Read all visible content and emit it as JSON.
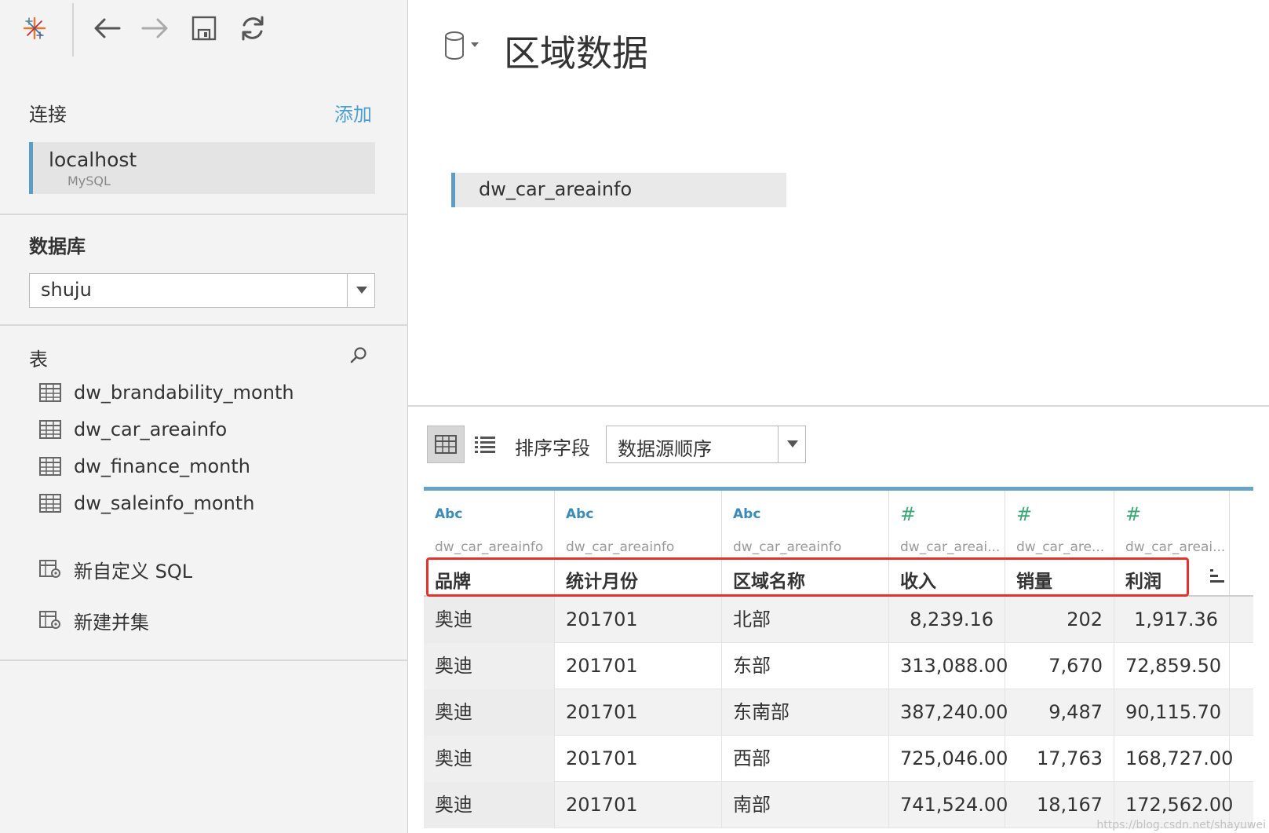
{
  "toolbar": {
    "icons": [
      "tableau-logo-icon",
      "back-arrow-icon",
      "forward-arrow-icon",
      "save-icon",
      "refresh-icon"
    ]
  },
  "sidebar": {
    "connection_label": "连接",
    "add_label": "添加",
    "connection": {
      "name": "localhost",
      "type": "MySQL"
    },
    "database_label": "数据库",
    "database_value": "shuju",
    "tables_label": "表",
    "tables": [
      {
        "label": "dw_brandability_month"
      },
      {
        "label": "dw_car_areainfo"
      },
      {
        "label": "dw_finance_month"
      },
      {
        "label": "dw_saleinfo_month"
      }
    ],
    "actions": [
      {
        "label": "新自定义 SQL"
      },
      {
        "label": "新建并集"
      }
    ]
  },
  "main": {
    "title": "区域数据",
    "canvas_table": "dw_car_areainfo",
    "grid_toolbar": {
      "sort_label": "排序字段",
      "sort_value": "数据源顺序"
    },
    "grid": {
      "columns": [
        {
          "type": "Abc",
          "source": "dw_car_areainfo",
          "name": "品牌"
        },
        {
          "type": "Abc",
          "source": "dw_car_areainfo",
          "name": "统计月份"
        },
        {
          "type": "Abc",
          "source": "dw_car_areainfo",
          "name": "区域名称"
        },
        {
          "type": "#",
          "source": "dw_car_areai...",
          "name": "收入"
        },
        {
          "type": "#",
          "source": "dw_car_are...",
          "name": "销量"
        },
        {
          "type": "#",
          "source": "dw_car_areai...",
          "name": "利润"
        }
      ],
      "rows": [
        [
          "奥迪",
          "201701",
          "北部",
          "8,239.16",
          "202",
          "1,917.36"
        ],
        [
          "奥迪",
          "201701",
          "东部",
          "313,088.00",
          "7,670",
          "72,859.50"
        ],
        [
          "奥迪",
          "201701",
          "东南部",
          "387,240.00",
          "9,487",
          "90,115.70"
        ],
        [
          "奥迪",
          "201701",
          "西部",
          "725,046.00",
          "17,763",
          "168,727.00"
        ],
        [
          "奥迪",
          "201701",
          "南部",
          "741,524.00",
          "18,167",
          "172,562.00"
        ]
      ]
    },
    "watermark": "https://blog.csdn.net/shayuwei"
  },
  "colors": {
    "accent_blue": "#5b9dc4",
    "link_blue": "#4b9fcf",
    "highlight_red": "#e8312f",
    "number_green": "#3aa874"
  }
}
